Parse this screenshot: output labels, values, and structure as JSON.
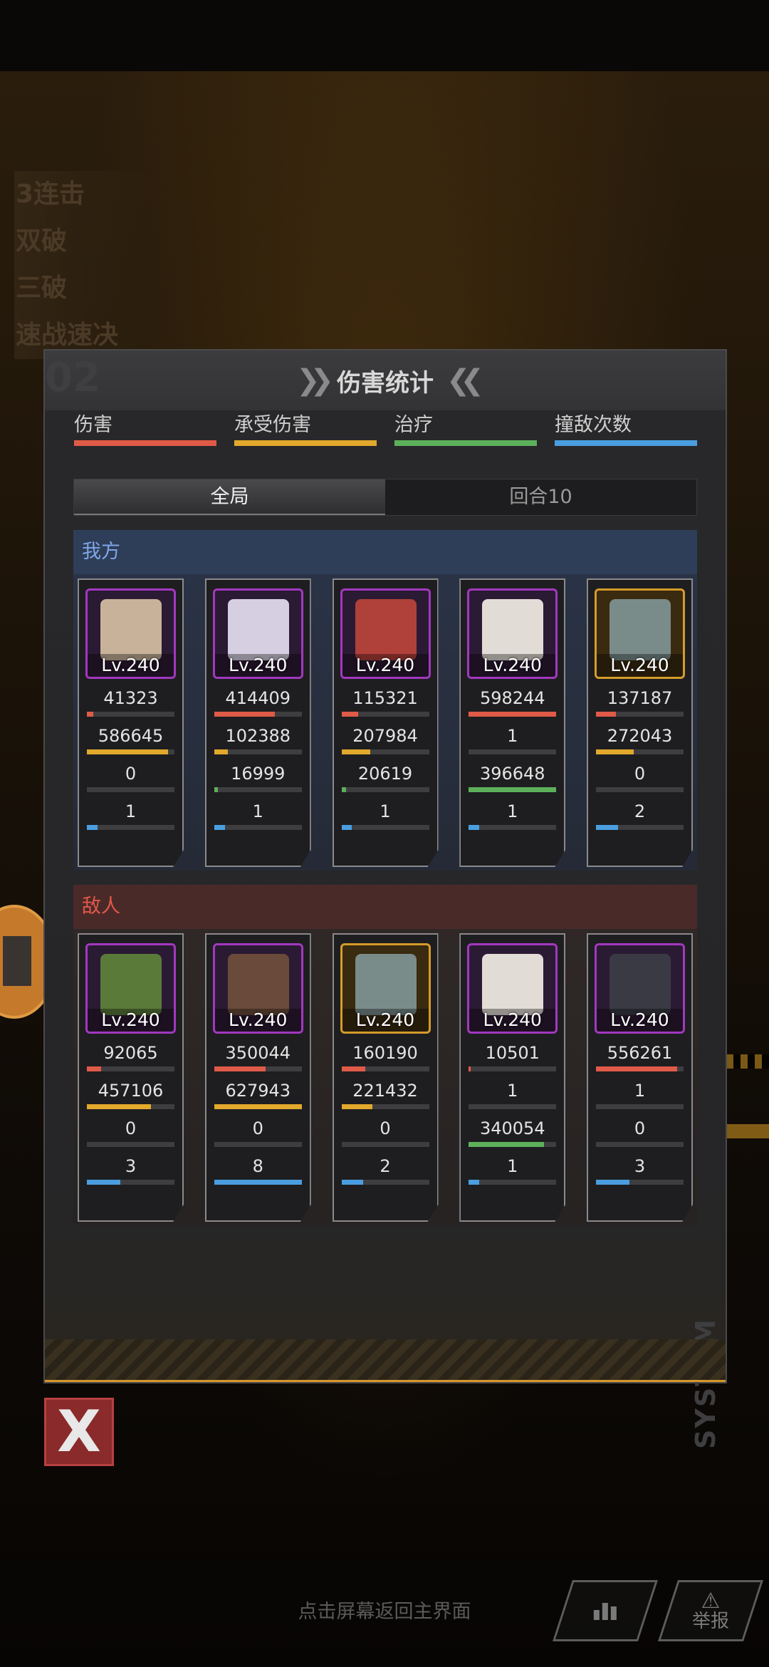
{
  "bonuses": [
    "3连击",
    "双破",
    "三破",
    "速战速决"
  ],
  "panel": {
    "title": "伤害统计",
    "watermark": "02",
    "system_text": "SYSTEM"
  },
  "legend": [
    {
      "label": "伤害",
      "color": "#e05a48"
    },
    {
      "label": "承受伤害",
      "color": "#e2a92c"
    },
    {
      "label": "治疗",
      "color": "#5cb05a"
    },
    {
      "label": "撞敌次数",
      "color": "#4a9ee0"
    }
  ],
  "tabs": [
    {
      "label": "全局",
      "active": true
    },
    {
      "label": "回合10",
      "active": false
    }
  ],
  "ally": {
    "label": "我方",
    "units": [
      {
        "level": "Lv.240",
        "frame": "purple",
        "face": "#c8b29a",
        "stats": [
          {
            "value": "41323",
            "fill": 0.07
          },
          {
            "value": "586645",
            "fill": 0.93
          },
          {
            "value": "0",
            "fill": 0
          },
          {
            "value": "1",
            "fill": 0.12
          }
        ]
      },
      {
        "level": "Lv.240",
        "frame": "purple",
        "face": "#d6cfe2",
        "stats": [
          {
            "value": "414409",
            "fill": 0.69
          },
          {
            "value": "102388",
            "fill": 0.16
          },
          {
            "value": "16999",
            "fill": 0.04
          },
          {
            "value": "1",
            "fill": 0.12
          }
        ]
      },
      {
        "level": "Lv.240",
        "frame": "purple",
        "face": "#b0403a",
        "stats": [
          {
            "value": "115321",
            "fill": 0.19
          },
          {
            "value": "207984",
            "fill": 0.33
          },
          {
            "value": "20619",
            "fill": 0.05
          },
          {
            "value": "1",
            "fill": 0.12
          }
        ]
      },
      {
        "level": "Lv.240",
        "frame": "purple",
        "face": "#e2dcd6",
        "stats": [
          {
            "value": "598244",
            "fill": 1.0
          },
          {
            "value": "1",
            "fill": 0
          },
          {
            "value": "396648",
            "fill": 1.0
          },
          {
            "value": "1",
            "fill": 0.12
          }
        ]
      },
      {
        "level": "Lv.240",
        "frame": "gold",
        "face": "#7a8c8a",
        "stats": [
          {
            "value": "137187",
            "fill": 0.23
          },
          {
            "value": "272043",
            "fill": 0.43
          },
          {
            "value": "0",
            "fill": 0
          },
          {
            "value": "2",
            "fill": 0.25
          }
        ]
      }
    ]
  },
  "enemy": {
    "label": "敌人",
    "units": [
      {
        "level": "Lv.240",
        "frame": "purple",
        "face": "#5a7a3a",
        "stats": [
          {
            "value": "92065",
            "fill": 0.16
          },
          {
            "value": "457106",
            "fill": 0.73
          },
          {
            "value": "0",
            "fill": 0
          },
          {
            "value": "3",
            "fill": 0.38
          }
        ]
      },
      {
        "level": "Lv.240",
        "frame": "purple",
        "face": "#6a4a3a",
        "stats": [
          {
            "value": "350044",
            "fill": 0.59
          },
          {
            "value": "627943",
            "fill": 1.0
          },
          {
            "value": "0",
            "fill": 0
          },
          {
            "value": "8",
            "fill": 1.0
          }
        ]
      },
      {
        "level": "Lv.240",
        "frame": "gold",
        "face": "#7a8c8a",
        "stats": [
          {
            "value": "160190",
            "fill": 0.27
          },
          {
            "value": "221432",
            "fill": 0.35
          },
          {
            "value": "0",
            "fill": 0
          },
          {
            "value": "2",
            "fill": 0.25
          }
        ]
      },
      {
        "level": "Lv.240",
        "frame": "purple",
        "face": "#e2dcd6",
        "stats": [
          {
            "value": "10501",
            "fill": 0.02
          },
          {
            "value": "1",
            "fill": 0
          },
          {
            "value": "340054",
            "fill": 0.86
          },
          {
            "value": "1",
            "fill": 0.12
          }
        ]
      },
      {
        "level": "Lv.240",
        "frame": "purple",
        "face": "#3a3a44",
        "stats": [
          {
            "value": "556261",
            "fill": 0.93
          },
          {
            "value": "1",
            "fill": 0
          },
          {
            "value": "0",
            "fill": 0
          },
          {
            "value": "3",
            "fill": 0.38
          }
        ]
      }
    ]
  },
  "close_label": "X",
  "hint": "点击屏幕返回主界面",
  "buttons": {
    "stats_icon": "bar-chart-icon",
    "report_label": "举报",
    "report_icon": "warning-icon"
  }
}
